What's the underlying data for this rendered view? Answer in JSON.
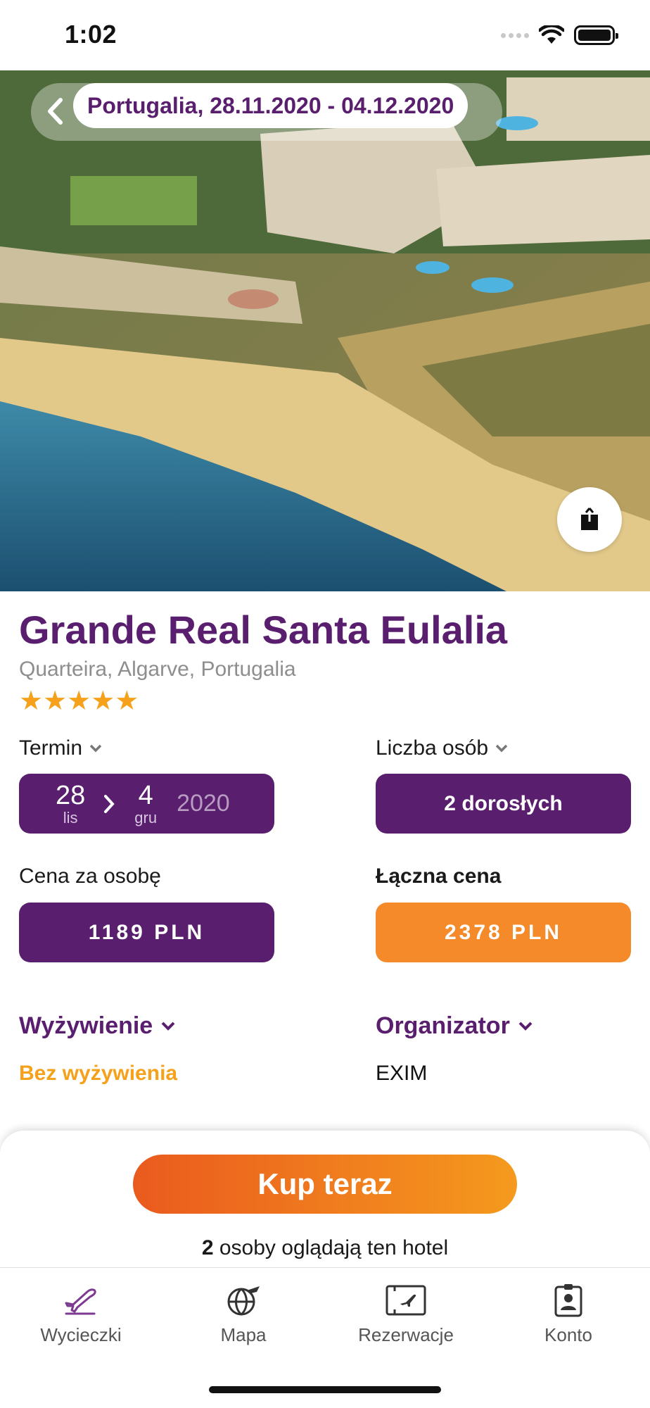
{
  "status_bar": {
    "time": "1:02"
  },
  "header": {
    "trip_summary": "Portugalia, 28.11.2020 - 04.12.2020"
  },
  "hotel": {
    "name": "Grande Real Santa Eulalia",
    "location": "Quarteira, Algarve, Portugalia",
    "stars": 5,
    "stars_text": "★★★★★"
  },
  "term": {
    "label": "Termin",
    "start_day": "28",
    "start_month": "lis",
    "end_day": "4",
    "end_month": "gru",
    "year": "2020"
  },
  "persons": {
    "label": "Liczba osób",
    "value": "2 dorosłych"
  },
  "price_per_person": {
    "label": "Cena za osobę",
    "value": "1189 PLN"
  },
  "total_price": {
    "label": "Łączna cena",
    "value": "2378 PLN"
  },
  "board": {
    "label": "Wyżywienie",
    "value": "Bez wyżywienia"
  },
  "organizer": {
    "label": "Organizator",
    "value": "EXIM"
  },
  "cta": {
    "buy_label": "Kup teraz",
    "viewers_count": "2",
    "viewers_text": "osoby oglądają ten hotel"
  },
  "tabs": [
    {
      "label": "Wycieczki",
      "icon": "plane-icon",
      "active": true
    },
    {
      "label": "Mapa",
      "icon": "globe-plane-icon",
      "active": false
    },
    {
      "label": "Rezerwacje",
      "icon": "ticket-icon",
      "active": false
    },
    {
      "label": "Konto",
      "icon": "account-badge-icon",
      "active": false
    }
  ],
  "colors": {
    "brand_purple": "#5a1e6e",
    "accent_orange": "#f58a2a",
    "star_color": "#f5a11c",
    "board_value": "#f5a11c"
  }
}
